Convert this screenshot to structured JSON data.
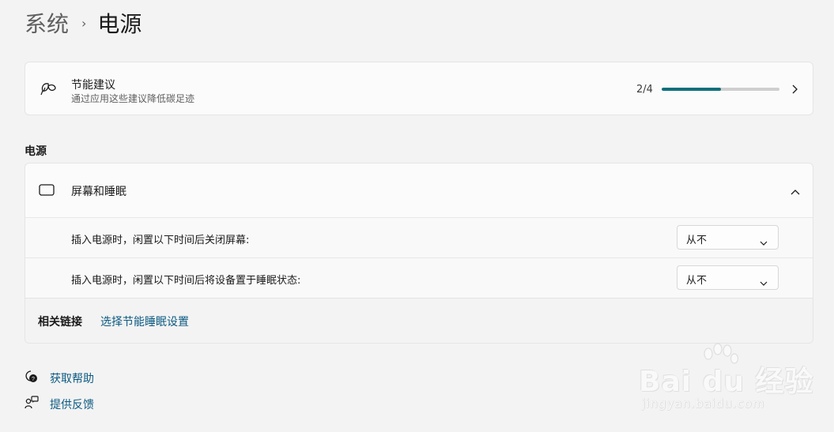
{
  "breadcrumb": {
    "parent": "系统",
    "separator": "›",
    "current": "电源"
  },
  "recommendations": {
    "title": "节能建议",
    "subtitle": "通过应用这些建议降低碳足迹",
    "count": "2/4",
    "progress": 0.5,
    "icon": "leaf-icon"
  },
  "section_label": "电源",
  "screen_sleep": {
    "title": "屏幕和睡眠",
    "icon": "screen-sleep-icon",
    "expanded": true,
    "settings": [
      {
        "label": "插入电源时，闲置以下时间后关闭屏幕:",
        "value": "从不"
      },
      {
        "label": "插入电源时，闲置以下时间后将设备置于睡眠状态:",
        "value": "从不"
      }
    ]
  },
  "related_links": {
    "label": "相关链接",
    "items": [
      "选择节能睡眠设置"
    ]
  },
  "help": {
    "get_help": "获取帮助",
    "feedback": "提供反馈"
  },
  "watermark": {
    "brand": "Bai du 经验",
    "url": "jingyan.baidu.com"
  },
  "colors": {
    "accent": "#0f6f7c",
    "link": "#0b5a82",
    "background": "#f3f3f3",
    "card": "#fbfbfb"
  }
}
